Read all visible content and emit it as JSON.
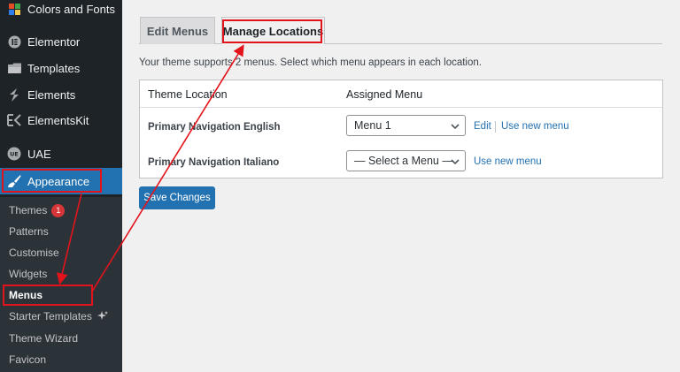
{
  "sidebar": {
    "items": [
      {
        "label": "Colors and Fonts",
        "icon": "color-grid-icon"
      },
      {
        "label": "Elementor",
        "icon": "elementor-icon"
      },
      {
        "label": "Templates",
        "icon": "folder-icon"
      },
      {
        "label": "Elements",
        "icon": "elements-icon"
      },
      {
        "label": "ElementsKit",
        "icon": "elementskit-icon"
      },
      {
        "label": "UAE",
        "icon": "uae-icon"
      },
      {
        "label": "Appearance",
        "icon": "paintbrush-icon"
      }
    ],
    "submenu": [
      {
        "label": "Themes",
        "badge": "1"
      },
      {
        "label": "Patterns"
      },
      {
        "label": "Customise"
      },
      {
        "label": "Widgets"
      },
      {
        "label": "Menus"
      },
      {
        "label": "Starter Templates"
      },
      {
        "label": "Theme Wizard"
      },
      {
        "label": "Favicon"
      }
    ]
  },
  "tabs": {
    "edit_label": "Edit Menus",
    "manage_label": "Manage Locations"
  },
  "intro": "Your theme supports 2 menus. Select which menu appears in each location.",
  "table": {
    "col_location": "Theme Location",
    "col_menu": "Assigned Menu",
    "rows": [
      {
        "location": "Primary Navigation English",
        "selected": "Menu 1",
        "edit_link": "Edit",
        "new_link": "Use new menu"
      },
      {
        "location": "Primary Navigation Italiano",
        "selected": "— Select a Menu —",
        "new_link": "Use new menu"
      }
    ]
  },
  "save_label": "Save Changes",
  "colors": {
    "sidebar_bg": "#1d2327",
    "accent": "#2271b1",
    "annotation": "#e3131b",
    "badge": "#d63638"
  }
}
